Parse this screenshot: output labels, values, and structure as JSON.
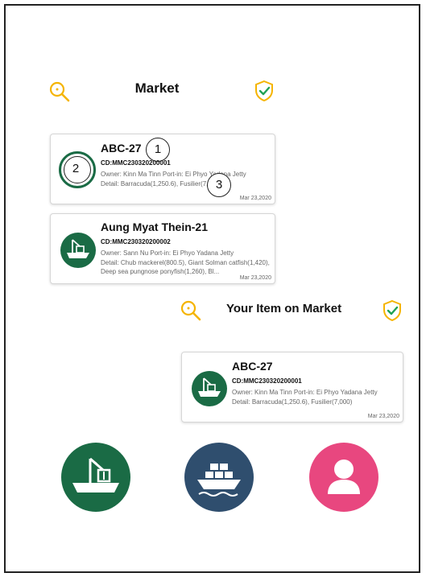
{
  "market": {
    "title": "Market",
    "items": [
      {
        "name": "ABC-27",
        "code": "CD:MMC230320200001",
        "owner_line": "Owner: Kinn Ma Tinn  Port-in: Ei Phyo Yadana Jetty",
        "detail": "Detail: Barracuda(1,250.6), Fusilier(7,000)",
        "date": "Mar 23,2020"
      },
      {
        "name": "Aung Myat Thein-21",
        "code": "CD:MMC230320200002",
        "owner_line": "Owner: Sann Nu  Port-in: Ei Phyo Yadana Jetty",
        "detail": "Detail: Chub mackerel(800.5), Giant Solman catfish(1,420), Deep sea pungnose ponyfish(1,260), Bl...",
        "date": "Mar 23,2020"
      }
    ]
  },
  "markers": [
    "1",
    "2",
    "3"
  ],
  "your_item": {
    "title": "Your Item on Market",
    "item": {
      "name": "ABC-27",
      "code": "CD:MMC230320200001",
      "owner_line": "Owner: Kinn Ma Tinn  Port-in: Ei Phyo Yadana Jetty",
      "detail": "Detail: Barracuda(1,250.6), Fusilier(7,000)",
      "date": "Mar 23,2020"
    }
  },
  "icons": {
    "search": "search-icon",
    "verified": "shield-check-icon",
    "boat": "fishing-boat-icon",
    "cargo": "cargo-ship-icon",
    "profile": "person-icon"
  },
  "colors": {
    "accent_yellow": "#f5b400",
    "green": "#1a6b45",
    "navy": "#2f4e6e",
    "pink": "#e8477f"
  }
}
